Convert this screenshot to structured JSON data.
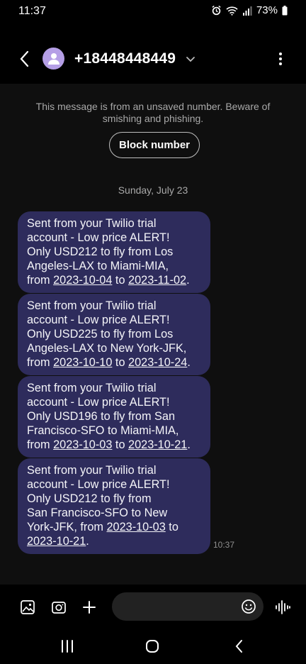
{
  "status_bar": {
    "time": "11:37",
    "battery_percent": "73%",
    "icons": [
      "alarm-icon",
      "wifi-icon",
      "signal-icon",
      "battery-icon"
    ]
  },
  "header": {
    "contact_number": "+18448448449",
    "icons": [
      "back-arrow-icon",
      "contact-avatar-icon",
      "chevron-down-icon",
      "more-vert-icon"
    ]
  },
  "conversation": {
    "warning_text": "This message is from an unsaved number. Beware of smishing and phishing.",
    "block_button_label": "Block number",
    "date_divider": "Sunday, July 23",
    "messages": [
      {
        "lines": [
          [
            {
              "t": "Sent from your Twilio trial"
            }
          ],
          [
            {
              "t": "account - Low price ALERT!"
            }
          ],
          [
            {
              "t": "Only USD212 to fly from Los"
            }
          ],
          [
            {
              "t": "Angeles-LAX to Miami-MIA,"
            }
          ],
          [
            {
              "t": "from "
            },
            {
              "t": "2023-10-04",
              "link": true
            },
            {
              "t": " to "
            },
            {
              "t": "2023-11-02",
              "link": true
            },
            {
              "t": "."
            }
          ]
        ]
      },
      {
        "lines": [
          [
            {
              "t": "Sent from your Twilio trial"
            }
          ],
          [
            {
              "t": "account - Low price ALERT!"
            }
          ],
          [
            {
              "t": "Only USD225 to fly from Los"
            }
          ],
          [
            {
              "t": "Angeles-LAX to New York-JFK,"
            }
          ],
          [
            {
              "t": "from "
            },
            {
              "t": "2023-10-10",
              "link": true
            },
            {
              "t": " to "
            },
            {
              "t": "2023-10-24",
              "link": true
            },
            {
              "t": "."
            }
          ]
        ]
      },
      {
        "lines": [
          [
            {
              "t": "Sent from your Twilio trial"
            }
          ],
          [
            {
              "t": "account - Low price ALERT!"
            }
          ],
          [
            {
              "t": "Only USD196 to fly from San"
            }
          ],
          [
            {
              "t": "Francisco-SFO to Miami-MIA,"
            }
          ],
          [
            {
              "t": "from "
            },
            {
              "t": "2023-10-03",
              "link": true
            },
            {
              "t": " to "
            },
            {
              "t": "2023-10-21",
              "link": true
            },
            {
              "t": "."
            }
          ]
        ]
      },
      {
        "lines": [
          [
            {
              "t": "Sent from your Twilio trial"
            }
          ],
          [
            {
              "t": "account - Low price ALERT!"
            }
          ],
          [
            {
              "t": "Only USD212 to fly from"
            }
          ],
          [
            {
              "t": "San Francisco-SFO to New"
            }
          ],
          [
            {
              "t": "York-JFK, from "
            },
            {
              "t": "2023-10-03",
              "link": true
            },
            {
              "t": " to"
            }
          ],
          [
            {
              "t": "2023-10-21",
              "link": true
            },
            {
              "t": "."
            }
          ]
        ]
      }
    ],
    "last_message_time": "10:37"
  },
  "composer": {
    "input_value": "",
    "icons": [
      "gallery-icon",
      "camera-icon",
      "plus-icon",
      "emoji-icon",
      "voice-wave-icon"
    ]
  },
  "navigation_bar": {
    "icons": [
      "recent-apps-icon",
      "home-icon",
      "back-icon"
    ]
  }
}
